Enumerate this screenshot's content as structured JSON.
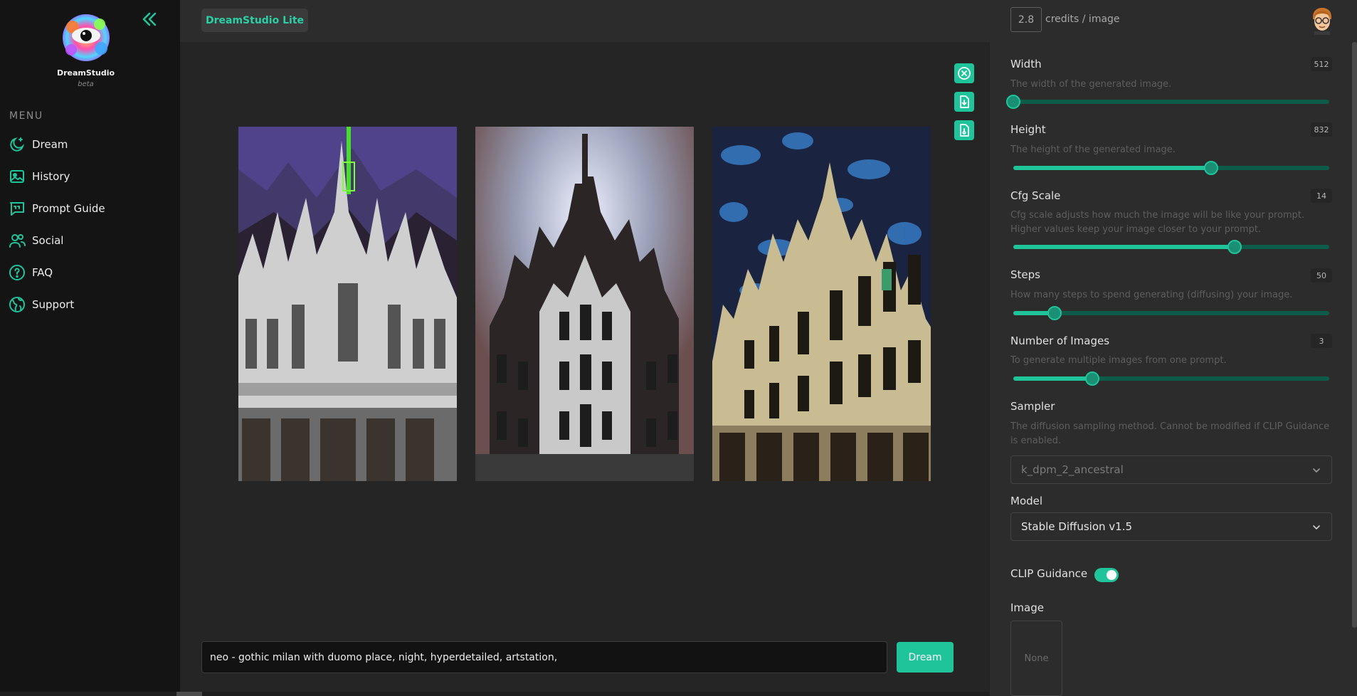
{
  "brand": {
    "name": "DreamStudio",
    "subtitle": "beta"
  },
  "sidebar": {
    "menu_label": "MENU",
    "items": [
      {
        "label": "Dream",
        "icon": "moon-stars-icon"
      },
      {
        "label": "History",
        "icon": "image-icon"
      },
      {
        "label": "Prompt Guide",
        "icon": "quote-bubble-icon"
      },
      {
        "label": "Social",
        "icon": "users-icon"
      },
      {
        "label": "FAQ",
        "icon": "question-circle-icon"
      },
      {
        "label": "Support",
        "icon": "globe-icon"
      }
    ]
  },
  "topbar": {
    "app_badge": "DreamStudio Lite",
    "credits_value": "2.8",
    "credits_label": "credits / image"
  },
  "images": [
    {
      "alt": "gothic cathedral generated image 1"
    },
    {
      "alt": "gothic cathedral generated image 2"
    },
    {
      "alt": "gothic cathedral generated image 3"
    }
  ],
  "image_actions": [
    "close-icon",
    "download-icon",
    "file-icon"
  ],
  "prompt": {
    "value": "neo - gothic milan with duomo place, night, hyperdetailed, artstation,",
    "dream_label": "Dream"
  },
  "settings": {
    "width": {
      "title": "Width",
      "value": "512",
      "desc": "The width of the generated image.",
      "fraction": 0.0
    },
    "height": {
      "title": "Height",
      "value": "832",
      "desc": "The height of the generated image.",
      "fraction": 0.625
    },
    "cfg": {
      "title": "Cfg Scale",
      "value": "14",
      "desc": "Cfg scale adjusts how much the image will be like your prompt. Higher values keep your image closer to your prompt.",
      "fraction": 0.7
    },
    "steps": {
      "title": "Steps",
      "value": "50",
      "desc": "How many steps to spend generating (diffusing) your image.",
      "fraction": 0.13
    },
    "num_images": {
      "title": "Number of Images",
      "value": "3",
      "desc": "To generate multiple images from one prompt.",
      "fraction": 0.25
    },
    "sampler": {
      "title": "Sampler",
      "desc": "The diffusion sampling method. Cannot be modified if CLIP Guidance is enabled.",
      "value": "k_dpm_2_ancestral"
    },
    "model": {
      "title": "Model",
      "value": "Stable Diffusion v1.5"
    },
    "clip_guidance": {
      "title": "CLIP Guidance",
      "enabled": true
    },
    "image": {
      "title": "Image",
      "value": "None"
    }
  },
  "colors": {
    "accent": "#1fc49b",
    "sidebar_bg": "#141414",
    "panel_bg": "#2c2c2c",
    "main_bg": "#252525"
  }
}
